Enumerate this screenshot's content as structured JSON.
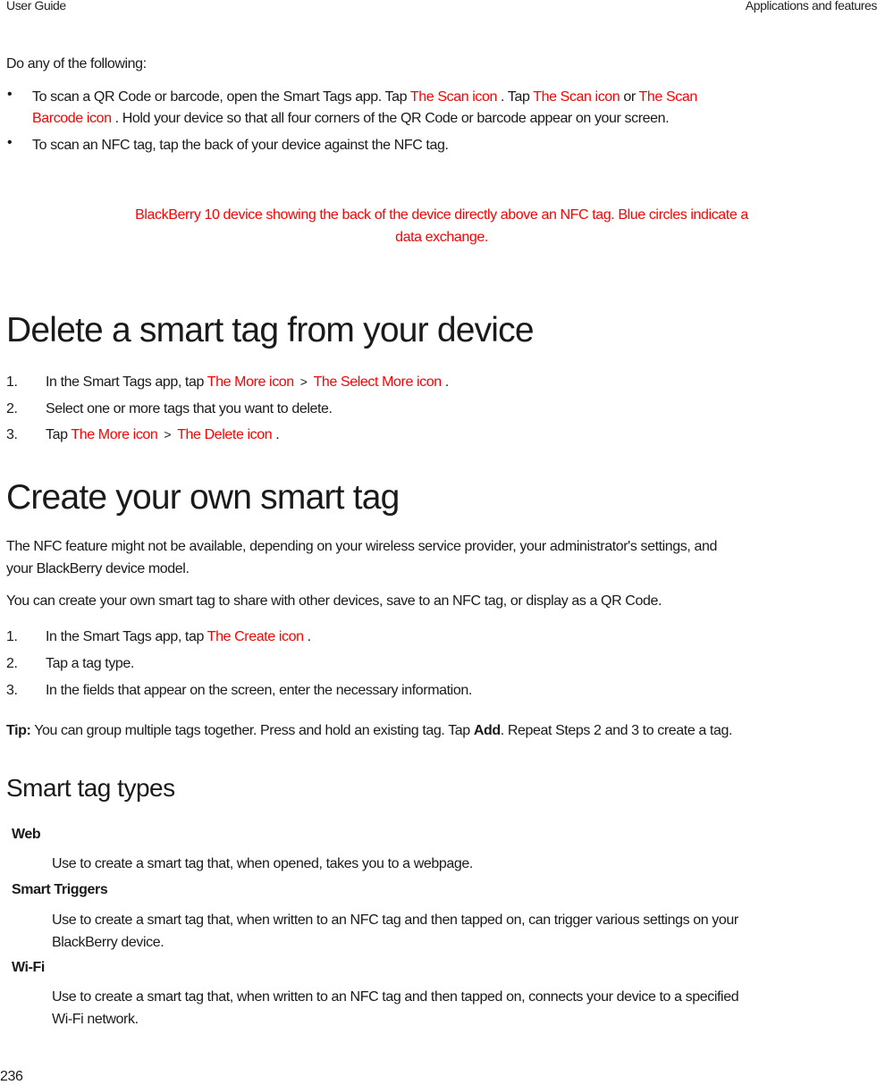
{
  "header": {
    "left": "User Guide",
    "right": "Applications and features"
  },
  "intro": "Do any of the following:",
  "bullets": [
    {
      "line1_a": "To scan a QR Code or barcode, open the Smart Tags app. Tap ",
      "line1_icon1": "The Scan icon",
      "line1_b": " . Tap ",
      "line1_icon2": "The Scan icon",
      "line1_c": "  or ",
      "line1_icon3": "The Scan",
      "line2_icon3": "Barcode icon",
      "line2_rest": " . Hold your device so that all four corners of the QR Code or barcode appear on your screen."
    },
    {
      "text": "To scan an NFC tag, tap the back of your device against the NFC tag."
    }
  ],
  "image_caption": {
    "line1": "BlackBerry 10 device showing the back of the device directly above an NFC tag. Blue circles indicate a",
    "line2": "data exchange."
  },
  "section_delete": {
    "title": "Delete a smart tag from your device",
    "steps": [
      {
        "num": "1.",
        "a": "In the Smart Tags app, tap ",
        "icon1": "The More icon",
        "sep": "  >  ",
        "icon2": "The Select More icon",
        "end": " ."
      },
      {
        "num": "2.",
        "text": "Select one or more tags that you want to delete."
      },
      {
        "num": "3.",
        "a": "Tap ",
        "icon1": "The More icon",
        "sep": "  >  ",
        "icon2": "The Delete icon",
        "end": " ."
      }
    ]
  },
  "section_create": {
    "title": "Create your own smart tag",
    "para1_line1": "The NFC feature might not be available, depending on your wireless service provider, your administrator's settings, and",
    "para1_line2": "your BlackBerry device model.",
    "para2": "You can create your own smart tag to share with other devices, save to an NFC tag, or display as a QR Code.",
    "steps": [
      {
        "num": "1.",
        "a": "In the Smart Tags app, tap ",
        "icon1": "The Create icon",
        "end": " ."
      },
      {
        "num": "2.",
        "text": "Tap a tag type."
      },
      {
        "num": "3.",
        "text": "In the fields that appear on the screen, enter the necessary information."
      }
    ],
    "tip": {
      "label": "Tip:",
      "a": " You can group multiple tags together. Press and hold an existing tag. Tap ",
      "bold": "Add",
      "b": ". Repeat Steps 2 and 3 to create a tag."
    }
  },
  "section_types": {
    "title": "Smart tag types",
    "items": [
      {
        "term": "Web",
        "def_line1": "Use to create a smart tag that, when opened, takes you to a webpage."
      },
      {
        "term": "Smart Triggers",
        "def_line1": "Use to create a smart tag that, when written to an NFC tag and then tapped on, can trigger various settings on your",
        "def_line2": "BlackBerry device."
      },
      {
        "term": "Wi-Fi",
        "def_line1": "Use to create a smart tag that, when written to an NFC tag and then tapped on, connects your device to a specified",
        "def_line2": "Wi-Fi network."
      }
    ]
  },
  "page_number": "236",
  "colors": {
    "placeholder_text": "#ff0000",
    "body_text": "#1a1a1a"
  }
}
